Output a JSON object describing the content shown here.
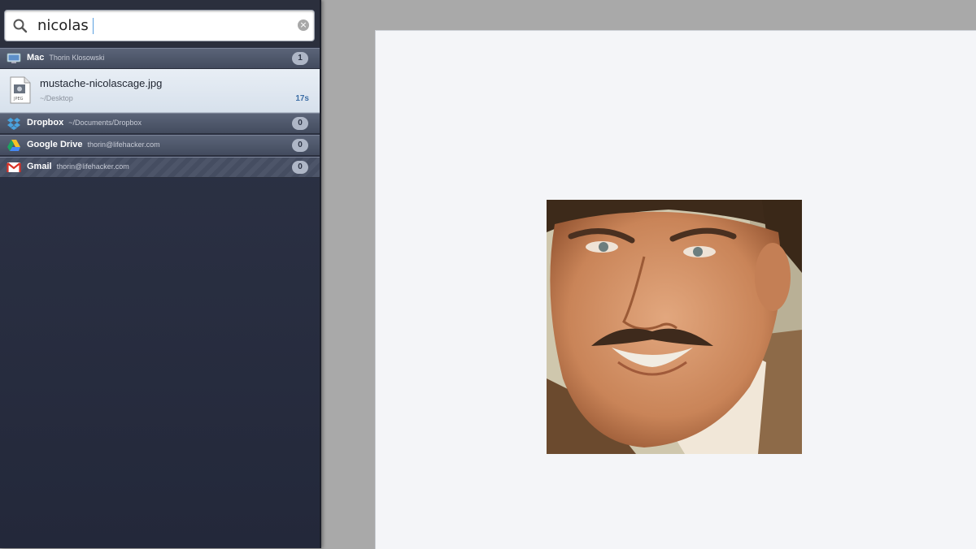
{
  "search": {
    "query": "nicolas"
  },
  "groups": [
    {
      "name": "Mac",
      "sub": "Thorin Klosowski",
      "count": "1",
      "icon": "mac-icon"
    },
    {
      "name": "Dropbox",
      "sub": "~/Documents/Dropbox",
      "count": "0",
      "icon": "dropbox-icon"
    },
    {
      "name": "Google Drive",
      "sub": "thorin@lifehacker.com",
      "count": "0",
      "icon": "google-drive-icon"
    },
    {
      "name": "Gmail",
      "sub": "thorin@lifehacker.com",
      "count": "0",
      "icon": "gmail-icon"
    }
  ],
  "result": {
    "filename": "mustache-nicolascage.jpg",
    "path": "~/Desktop",
    "age": "17s",
    "icon_label": "JPEG"
  },
  "colors": {
    "panel": "#282d3f",
    "accent": "#3e6fa6",
    "canvas": "#f4f5f8"
  }
}
